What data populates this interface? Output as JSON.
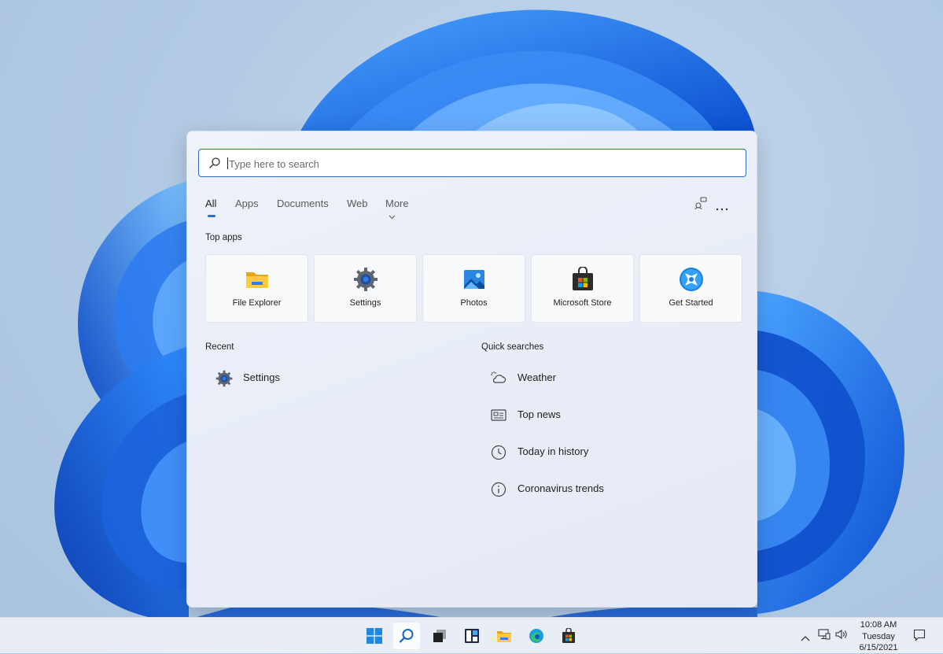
{
  "search": {
    "placeholder": "Type here to search"
  },
  "tabs": [
    {
      "label": "All",
      "active": true
    },
    {
      "label": "Apps"
    },
    {
      "label": "Documents"
    },
    {
      "label": "Web"
    },
    {
      "label": "More"
    }
  ],
  "tab_actions": {
    "icons": [
      "account-switch-icon",
      "more-options-icon"
    ]
  },
  "top_apps": {
    "title": "Top apps",
    "items": [
      {
        "label": "File Explorer",
        "icon": "folder-icon"
      },
      {
        "label": "Settings",
        "icon": "gear-icon"
      },
      {
        "label": "Photos",
        "icon": "photos-icon"
      },
      {
        "label": "Microsoft Store",
        "icon": "store-bag-icon"
      },
      {
        "label": "Get Started",
        "icon": "get-started-icon"
      }
    ]
  },
  "recent": {
    "title": "Recent",
    "items": [
      {
        "label": "Settings",
        "icon": "gear-icon"
      }
    ]
  },
  "quick_searches": {
    "title": "Quick searches",
    "items": [
      {
        "label": "Weather",
        "icon": "weather-icon"
      },
      {
        "label": "Top news",
        "icon": "news-icon"
      },
      {
        "label": "Today in history",
        "icon": "clock-icon"
      },
      {
        "label": "Coronavirus trends",
        "icon": "info-icon"
      }
    ]
  },
  "taskbar": {
    "icons": [
      "windows-start-icon",
      "search-icon",
      "task-view-icon",
      "widgets-icon",
      "file-explorer-icon",
      "edge-icon",
      "store-icon"
    ],
    "active": "search-icon"
  },
  "tray": {
    "icons": [
      "chevron-up-icon",
      "network-icon",
      "volume-icon",
      "notification-icon"
    ],
    "time": "10:08 AM",
    "day": "Tuesday",
    "date": "6/15/2021"
  },
  "colors": {
    "accent": "#2c6cc4",
    "wallpaper_blue": "#1a6fe8"
  }
}
